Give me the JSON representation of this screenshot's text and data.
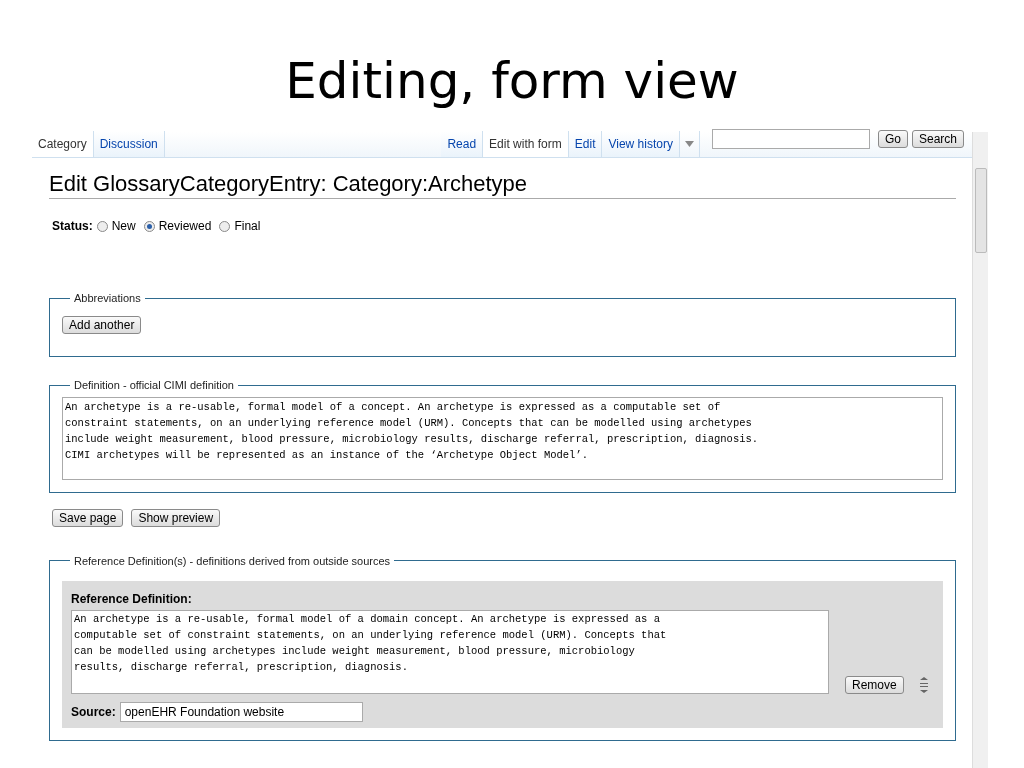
{
  "slide_title": "Editing, form view",
  "left_tabs": [
    {
      "label": "Category",
      "selected": true
    },
    {
      "label": "Discussion",
      "selected": false
    }
  ],
  "right_tabs": [
    {
      "label": "Read",
      "selected": false
    },
    {
      "label": "Edit with form",
      "selected": true
    },
    {
      "label": "Edit",
      "selected": false
    },
    {
      "label": "View history",
      "selected": false
    }
  ],
  "search": {
    "go_button": "Go",
    "search_button": "Search"
  },
  "page_title": "Edit GlossaryCategoryEntry: Category:Archetype",
  "status": {
    "label": "Status:",
    "options": [
      {
        "label": "New",
        "selected": false
      },
      {
        "label": "Reviewed",
        "selected": true
      },
      {
        "label": "Final",
        "selected": false
      }
    ]
  },
  "abbreviations": {
    "legend": "Abbreviations",
    "button": "Add another"
  },
  "definition": {
    "legend": "Definition - official CIMI definition",
    "value": "An archetype is a re-usable, formal model of a concept. An archetype is expressed as a computable set of\nconstraint statements, on an underlying reference model (URM). Concepts that can be modelled using archetypes\ninclude weight measurement, blood pressure, microbiology results, discharge referral, prescription, diagnosis.\nCIMI archetypes will be represented as an instance of the ‘Archetype Object Model’."
  },
  "actions": [
    "Save page",
    "Show preview"
  ],
  "reference": {
    "legend": "Reference Definition(s) - definitions derived from outside sources",
    "label": "Reference Definition:",
    "value": "An archetype is a re-usable, formal model of a domain concept. An archetype is expressed as a\ncomputable set of constraint statements, on an underlying reference model (URM). Concepts that\ncan be modelled using archetypes include weight measurement, blood pressure, microbiology\nresults, discharge referral, prescription, diagnosis.",
    "remove_button": "Remove",
    "source_label": "Source:",
    "source_value": "openEHR Foundation website"
  }
}
